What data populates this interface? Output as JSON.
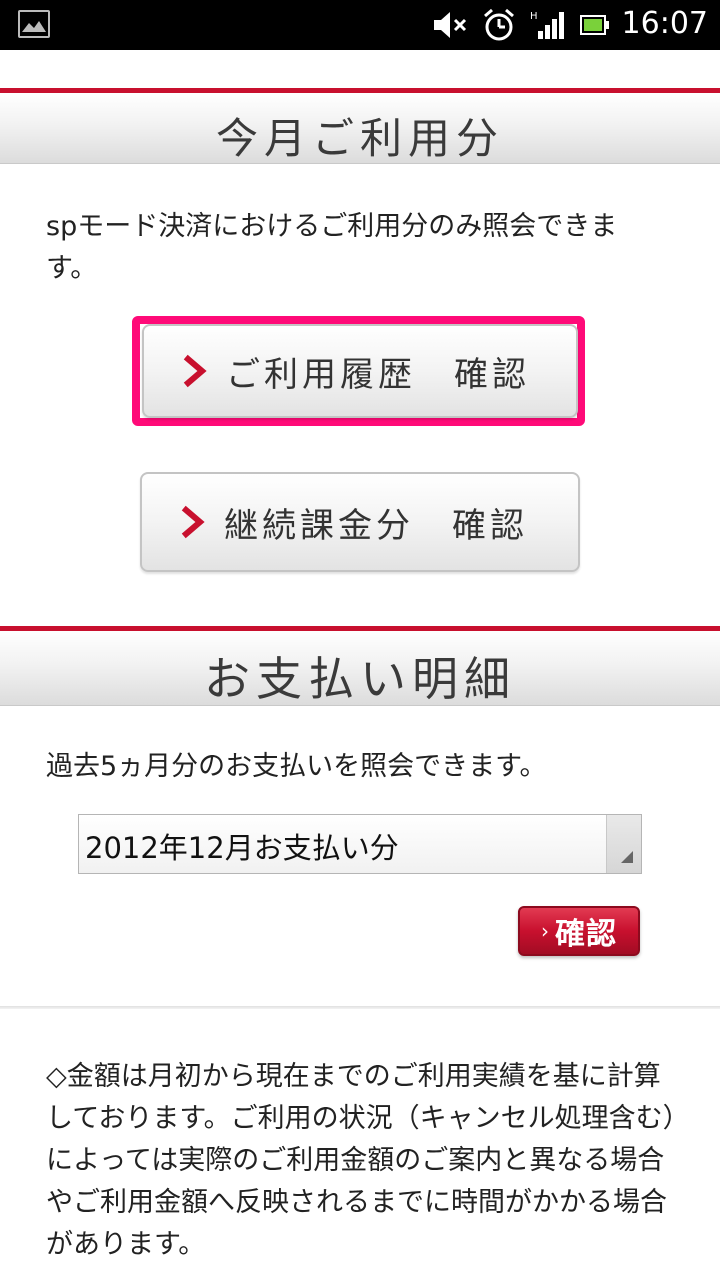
{
  "status_bar": {
    "time": "16:07",
    "icons": [
      "image-icon",
      "mute-icon",
      "alarm-icon",
      "signal-icon",
      "battery-icon"
    ]
  },
  "section_current": {
    "title": "今月ご利用分",
    "description": "spモード決済におけるご利用分のみ照会できます。",
    "history_button": "ご利用履歴　確認",
    "continuous_button": "継続課金分　確認"
  },
  "section_payment": {
    "title": "お支払い明細",
    "description": "過去5ヵ月分のお支払いを照会できます。",
    "select_value": "2012年12月お支払い分",
    "confirm_button": "確認"
  },
  "note": "◇金額は月初から現在までのご利用実績を基に計算しております。ご利用の状況（キャンセル処理含む）によっては実際のご利用金額のご案内と異なる場合やご利用金額へ反映されるまでに時間がかかる場合があります。",
  "colors": {
    "accent_red": "#c8102e",
    "highlight_pink": "#ff0a78"
  }
}
